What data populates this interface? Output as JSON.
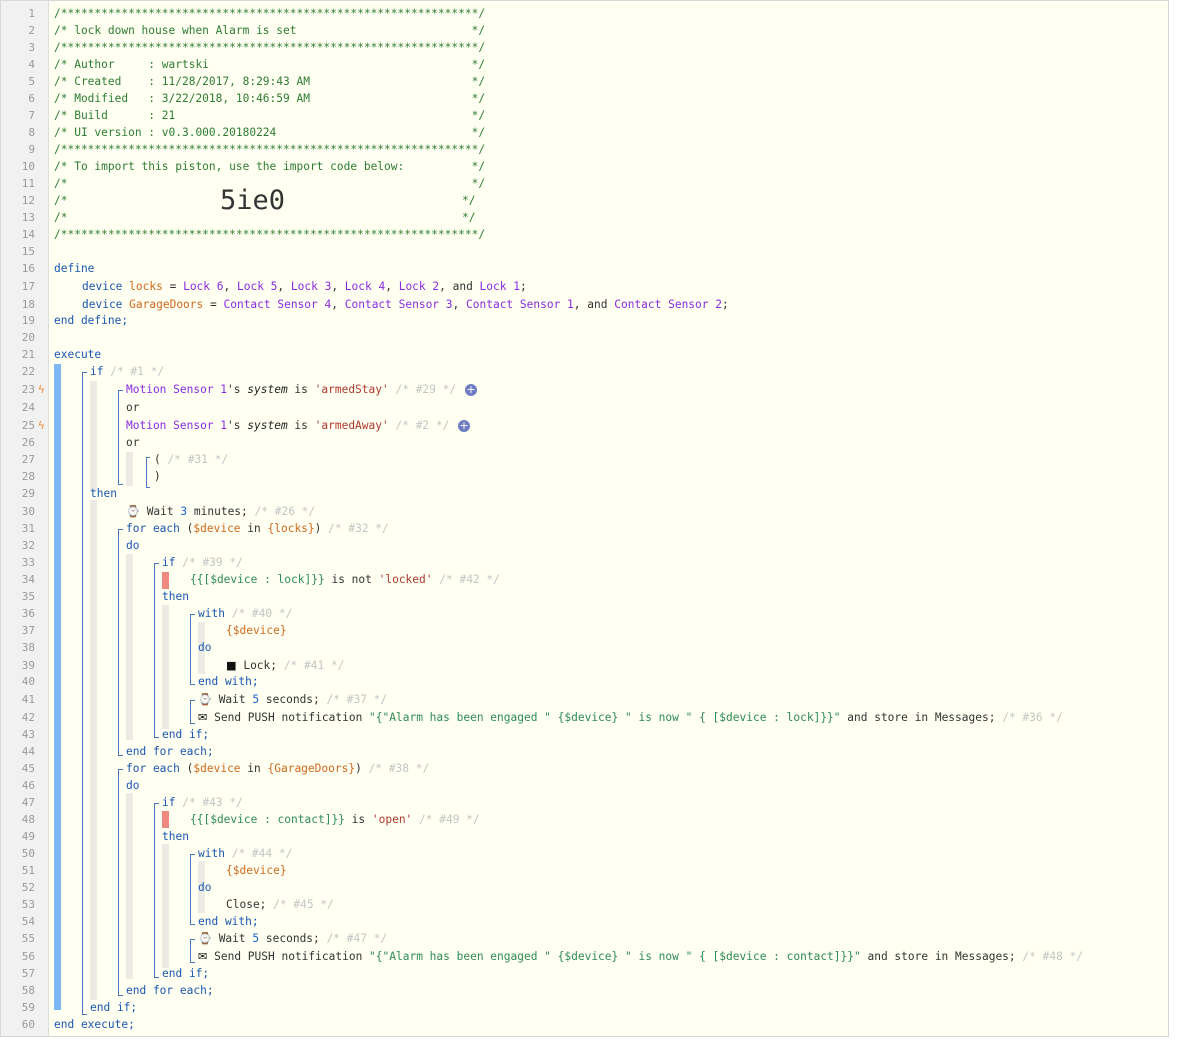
{
  "line_numbers": [
    "1",
    "2",
    "3",
    "4",
    "5",
    "6",
    "7",
    "8",
    "9",
    "10",
    "11",
    "12",
    "13",
    "14",
    "15",
    "16",
    "17",
    "18",
    "19",
    "20",
    "21",
    "22",
    "23",
    "24",
    "25",
    "26",
    "27",
    "28",
    "29",
    "30",
    "31",
    "32",
    "33",
    "34",
    "35",
    "36",
    "37",
    "38",
    "39",
    "40",
    "41",
    "42",
    "43",
    "44",
    "45",
    "46",
    "47",
    "48",
    "49",
    "50",
    "51",
    "52",
    "53",
    "54",
    "55",
    "56",
    "57",
    "58",
    "59",
    "60"
  ],
  "header": {
    "border": "/**************************************************************/",
    "line2": "/* lock down house when Alarm is set                          */",
    "line4": "/* Author     : wartski                                       */",
    "line5": "/* Created    : 11/28/2017, 8:29:43 AM                        */",
    "line6": "/* Modified   : 3/22/2018, 10:46:59 AM                        */",
    "line7": "/* Build      : 21                                            */",
    "line8": "/* UI version : v0.3.000.20180224                             */",
    "line10": "/* To import this piston, use the import code below:          */",
    "blank_comment": "/*                                                            */",
    "blank_open": "/*",
    "blank_close": "*/",
    "import_code": "5ie0"
  },
  "define_block": {
    "define_kw": "define",
    "device_kw": "device",
    "locks_var": "locks",
    "locks_devices": [
      "Lock 6",
      "Lock 5",
      "Lock 3",
      "Lock 4",
      "Lock 2",
      "Lock 1"
    ],
    "garage_var": "GarageDoors",
    "garage_devices": [
      "Contact Sensor 4",
      "Contact Sensor 3",
      "Contact Sensor 1",
      "Contact Sensor 2"
    ],
    "equals": " = ",
    "comma": ", ",
    "and": ", and ",
    "semi": ";",
    "end_define": "end define;"
  },
  "execute_block": {
    "execute_kw": "execute",
    "if1": "if",
    "if1_comment": "/* #1 */",
    "cond1_device": "Motion Sensor 1",
    "cond1_attr_prefix": "'s ",
    "cond1_attr": "system",
    "cond1_is": " is ",
    "cond1_value": "'armedStay'",
    "cond1_comment": "/* #29 */",
    "or1": "or",
    "cond2_device": "Motion Sensor 1",
    "cond2_value": "'armedAway'",
    "cond2_comment": "/* #2 */",
    "or2": "or",
    "group_open": "(",
    "group_comment": "/* #31 */",
    "group_close": ")",
    "then1": "then",
    "wait1_label": "Wait",
    "wait1_value": "3",
    "wait1_unit": "minutes;",
    "wait1_comment": "/* #26 */",
    "foreach1_kw": "for each",
    "foreach1_var": "$device",
    "foreach1_in": " in ",
    "foreach1_list": "{locks}",
    "foreach1_comment": "/* #32 */",
    "do1": "do",
    "if2": "if",
    "if2_comment": "/* #39 */",
    "cond3_expr": "{{[$device : lock]}}",
    "cond3_op": " is not ",
    "cond3_value": "'locked'",
    "cond3_comment": "/* #42 */",
    "then2": "then",
    "with1": "with",
    "with1_comment": "/* #40 */",
    "with1_device": "{$device}",
    "do2": "do",
    "lock_action": "Lock;",
    "lock_comment": "/* #41 */",
    "endwith1": "end with;",
    "wait2_label": "Wait",
    "wait2_value": "5",
    "wait2_unit": "seconds;",
    "wait2_comment": "/* #37 */",
    "push1_label": "Send PUSH notification ",
    "push1_msg": "\"{\"Alarm has been engaged \" {$device} \" is now \" { [$device : lock]}}\"",
    "push1_store": " and store in Messages;",
    "push1_comment": "/* #36 */",
    "endif2": "end if;",
    "endfor1": "end for each;",
    "foreach2_kw": "for each",
    "foreach2_var": "$device",
    "foreach2_list": "{GarageDoors}",
    "foreach2_comment": "/* #38 */",
    "do3": "do",
    "if3": "if",
    "if3_comment": "/* #43 */",
    "cond4_expr": "{{[$device : contact]}}",
    "cond4_op": " is ",
    "cond4_value": "'open'",
    "cond4_comment": "/* #49 */",
    "then3": "then",
    "with2": "with",
    "with2_comment": "/* #44 */",
    "with2_device": "{$device}",
    "do4": "do",
    "close_action": "Close;",
    "close_comment": "/* #45 */",
    "endwith2": "end with;",
    "wait3_label": "Wait",
    "wait3_value": "5",
    "wait3_unit": "seconds;",
    "wait3_comment": "/* #47 */",
    "push2_label": "Send PUSH notification ",
    "push2_msg": "\"{\"Alarm has been engaged \" {$device} \" is now \" { [$device : contact]}}\"",
    "push2_store": " and store in Messages;",
    "push2_comment": "/* #48 */",
    "endif3": "end if;",
    "endfor2": "end for each;",
    "endif1": "end if;",
    "end_execute": "end execute;"
  },
  "icons": {
    "trigger": "lightning-bolt-icon",
    "clock": "clock-icon",
    "lock": "padlock-icon",
    "chat": "speech-bubble-icon",
    "add": "add-condition-icon"
  },
  "colors": {
    "background": "#fffff2",
    "keyword": "#1a57b0",
    "device": "#8a2be2",
    "variable": "#d2691e",
    "string": "#b03a2e",
    "comment": "#2e7d32",
    "dim_comment": "#c4c4c4",
    "trigger_bar": "#7cb7f6",
    "condition_flag": "#f08a80"
  }
}
